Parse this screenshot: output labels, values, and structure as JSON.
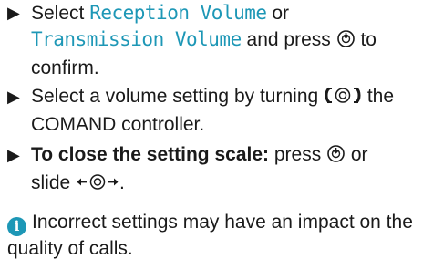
{
  "steps": [
    {
      "select": "Select ",
      "reception": "Reception Volume",
      "or": " or",
      "transmission": "Transmission Volume",
      "press": " and press ",
      "confirm": " to confirm."
    },
    {
      "text1": "Select a volume setting by turning ",
      "text2": " the COMAND controller."
    },
    {
      "bold": "To close the setting scale:",
      "text1": " press ",
      "text2": " or slide ",
      "text3": "."
    }
  ],
  "info": {
    "icon_label": "i",
    "text": "Incorrect settings may have an impact on the quality of calls."
  },
  "colors": {
    "accent": "#1d97b6",
    "text": "#1a1a1a"
  },
  "icons": {
    "bullet": "triangle-right-bullet",
    "press": "press-controller-icon",
    "turn": "turn-controller-icon",
    "slide": "slide-controller-icon",
    "info": "info-icon"
  }
}
